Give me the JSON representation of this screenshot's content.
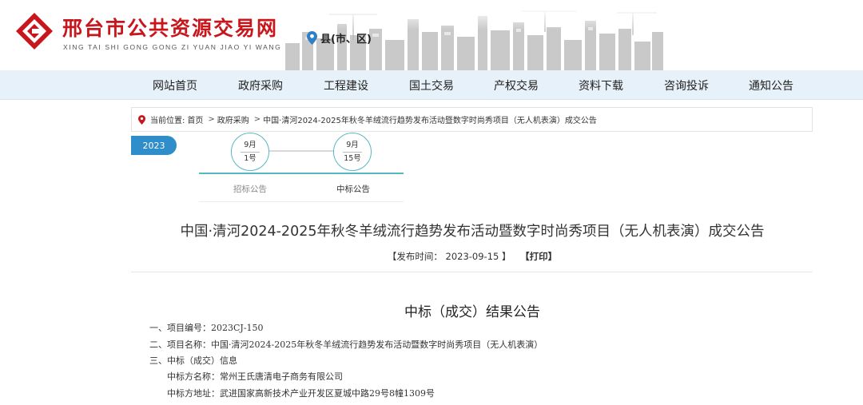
{
  "header": {
    "site_title": "邢台市公共资源交易网",
    "site_subtitle": "XING TAI SHI GONG GONG ZI YUAN JIAO YI WANG",
    "region_selector": "县(市、区)",
    "brand_color": "#c8161d"
  },
  "nav": {
    "items": [
      "网站首页",
      "政府采购",
      "工程建设",
      "国土交易",
      "产权交易",
      "资料下载",
      "咨询投诉",
      "通知公告"
    ]
  },
  "breadcrumb": {
    "prefix": "当前位置:",
    "items": [
      "首页",
      "政府采购",
      "中国·清河2024-2025年秋冬羊绒流行趋势发布活动暨数字时尚秀项目（无人机表演）成交公告"
    ],
    "separator": ">"
  },
  "timeline": {
    "year": "2023",
    "nodes": [
      {
        "month": "9月",
        "day": "1号",
        "label": "招标公告"
      },
      {
        "month": "9月",
        "day": "15号",
        "label": "中标公告"
      }
    ],
    "accent_color": "#58b8c2"
  },
  "article": {
    "title": "中国·清河2024-2025年秋冬羊绒流行趋势发布活动暨数字时尚秀项目（无人机表演）成交公告",
    "publish_prefix": "【发布时间：",
    "publish_date": "2023-09-15",
    "publish_suffix": "】",
    "print_label": "【打印】"
  },
  "document": {
    "heading": "中标（成交）结果公告",
    "lines": [
      "一、项目编号：2023CJ-150",
      "二、项目名称：中国·清河2024-2025年秋冬羊绒流行趋势发布活动暨数字时尚秀项目（无人机表演）",
      "三、中标（成交）信息",
      "中标方名称：常州王氏唐清电子商务有限公司",
      "中标方地址：武进国家高新技术产业开发区夏城中路29号8幢1309号"
    ]
  }
}
